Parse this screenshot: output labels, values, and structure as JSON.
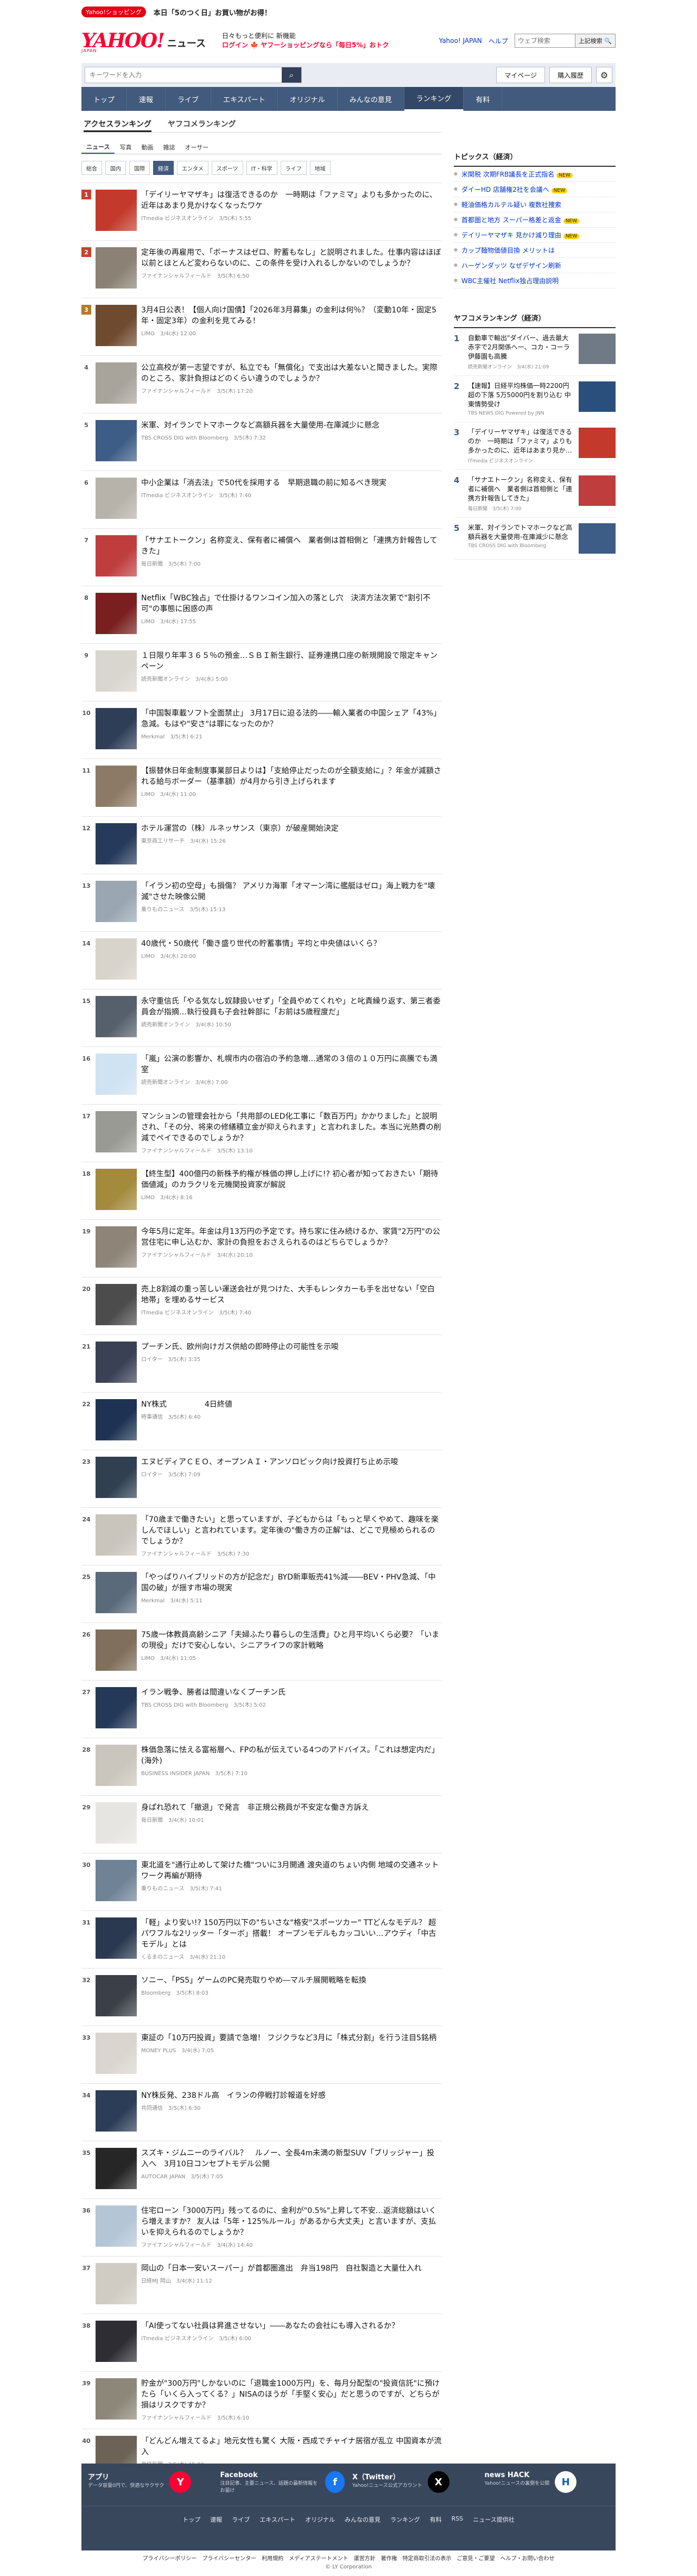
{
  "promo": {
    "pill": "Yahoo!ショッピング",
    "text": "本日「5のつく日」お買い物がお得！"
  },
  "header": {
    "logo_text": "YAHOO!",
    "logo_sub": "JAPAN",
    "section": "ニュース",
    "promo_l1": "日々もっと便利に 新機能",
    "promo_l2": "ログイン 🍁 ヤフーショッピングなら「毎日5%」おトク",
    "link_yj": "Yahoo! JAPAN",
    "link_help": "ヘルプ",
    "search_placeholder": "ウェブ検索",
    "search_btn": "上記検索 🔍"
  },
  "searchbar": {
    "placeholder": "キーワードを入力",
    "mypage": "マイページ",
    "subscribe": "購入履歴"
  },
  "mainnav": [
    "トップ",
    "速報",
    "ライブ",
    "エキスパート",
    "オリジナル",
    "みんなの意見",
    "ランキング",
    "有料"
  ],
  "mainnav_active": 6,
  "pagetabs": [
    "アクセスランキング",
    "ヤフコメランキング"
  ],
  "typetabs": [
    "ニュース",
    "写真",
    "動画",
    "雑誌",
    "オーサー"
  ],
  "cattabs": [
    "総合",
    "国内",
    "国際",
    "経済",
    "エンタメ",
    "スポーツ",
    "IT・科学",
    "ライフ",
    "地域"
  ],
  "ranking": [
    {
      "n": "1",
      "title": "「デイリーヤマザキ」は復活できるのか　一時期は「ファミマ」よりも多かったのに、近年はあまり見かけなくなったワケ",
      "meta": "ITmedia ビジネスオンライン　3/5(木) 5:55",
      "c": "#c33a2c"
    },
    {
      "n": "2",
      "title": "定年後の再雇用で、「ボーナスはゼロ、貯蓄もなし」と説明されました。仕事内容はほぼ以前とほとんど変わらないのに、この条件を受け入れるしかないのでしょうか？",
      "meta": "ファイナンシャルフィールド　3/5(木) 6:50",
      "c": "#8b8175"
    },
    {
      "n": "3",
      "title": "3月4日公表！【個人向け国債】「2026年3月募集」の金利は何％？（変動10年・固定5年・固定3年）の金利を見てみる！",
      "meta": "LIMO　3/4(水) 12:00",
      "c": "#6e4a2e"
    },
    {
      "n": "4",
      "title": "公立高校が第一志望ですが、私立でも「無償化」で支出は大差ないと聞きました。実際のところ、家計負担はどのくらい違うのでしょうか？",
      "meta": "ファイナンシャルフィールド　3/5(木) 17:20",
      "c": "#a8a39b"
    },
    {
      "n": "5",
      "title": "米軍、対イランでトマホークなど高額兵器を大量使用-在庫減少に懸念",
      "meta": "TBS CROSS DIG with Bloomberg　3/5(木) 7:32",
      "c": "#3d5c86"
    },
    {
      "n": "6",
      "title": "中小企業は「消去法」で50代を採用する　早期退職の前に知るべき現実",
      "meta": "ITmedia ビジネスオンライン　3/5(木) 7:40",
      "c": "#b8b3aa"
    },
    {
      "n": "7",
      "title": "「サナエトークン」名称変え、保有者に補償へ　業者側は首相側と「連携方針報告してきた」",
      "meta": "毎日新聞　3/5(木) 7:00",
      "c": "#bf3d3d"
    },
    {
      "n": "8",
      "title": "Netflix「WBC独占」で仕掛けるワンコイン加入の落とし穴　決済方法次第で\"割引不可\"の事態に困惑の声",
      "meta": "LIMO　3/4(水) 17:55",
      "c": "#7a1f1f"
    },
    {
      "n": "9",
      "title": "１日限り年率３６５％の預金…ＳＢＩ新生銀行、証券連携口座の新規開設で限定キャンペーン",
      "meta": "読売新聞オンライン　3/4(水) 5:00",
      "c": "#d9d5cf"
    },
    {
      "n": "10",
      "title": "「中国製車載ソフト全面禁止」 3月17日に迫る法的――輸入業者の中国シェア「43%」急減。もはや\"安さ\"は罪になったのか？",
      "meta": "Merkmal　3/5(木) 6:21",
      "c": "#2f3e57"
    },
    {
      "n": "11",
      "title": "【振替休日年金制度事業部日よりは】「支給停止だったのが全額支給に」？年金が減額される給与ボーダー（基準額）が4月から引き上げられます",
      "meta": "LIMO　3/4(水) 11:00",
      "c": "#8c7a66"
    },
    {
      "n": "12",
      "title": "ホテル運営の（株）ルネッサンス（東京）が破産開始決定",
      "meta": "東京商工リサーチ　3/4(水) 15:26",
      "c": "#263a5c"
    },
    {
      "n": "13",
      "title": "「イラン初の空母」も損傷？ アメリカ海軍「オマーン湾に艦艇はゼロ」海上戦力を\"壊滅\"させた映像公開",
      "meta": "乗りものニュース　3/5(木) 15:13",
      "c": "#9aa6b2"
    },
    {
      "n": "14",
      "title": "40歳代・50歳代「働き盛り世代の貯蓄事情」平均と中央値はいくら？",
      "meta": "LIMO　3/4(水) 20:00",
      "c": "#d8d3cb"
    },
    {
      "n": "15",
      "title": "永守重信氏「やる気なし奴隷扱いせず」「全員やめてくれや」と叱責繰り返す、第三者委員会が指摘…執行役員も子会社幹部に「お前は5歳程度だ」",
      "meta": "読売新聞オンライン　3/4(水) 10:50",
      "c": "#56606c"
    },
    {
      "n": "16",
      "title": "「嵐」公演の影響か、札幌市内の宿泊の予約急増…通常の３倍の１０万円に高騰でも満室",
      "meta": "読売新聞オンライン　3/4(水) 7:00",
      "c": "#cfe3f2"
    },
    {
      "n": "17",
      "title": "マンションの管理会社から「共用部のLED化工事に「数百万円」かかりました」と説明され、「その分、将来の修繕積立金が抑えられます」と言われました。本当に光熱費の削減でペイできるのでしょうか？",
      "meta": "ファイナンシャルフィールド　3/5(木) 13:10",
      "c": "#9a9a94"
    },
    {
      "n": "18",
      "title": "【終生型】400億円の新株予約権が株価の押し上げに!? 初心者が知っておきたい「期待価値減」のカラクリを元機関投資家が解説",
      "meta": "LIMO　3/4(水) 8:16",
      "c": "#a38a3c"
    },
    {
      "n": "19",
      "title": "今年5月に定年。年金は月13万円の予定です。持ち家に住み続けるか、家賃\"2万円\"の公営住宅に申し込むか、家計の負担をおさえられるのはどちらでしょうか？",
      "meta": "ファイナンシャルフィールド　3/4(水) 20:10",
      "c": "#8e8478"
    },
    {
      "n": "20",
      "title": "売上8割減の重っ苦しい運送会社が見つけた、大手もレンタカーも手を出せない「空白地帯」を埋めるサービス",
      "meta": "ITmedia ビジネスオンライン　3/5(木) 7:40",
      "c": "#4c4c4c"
    },
    {
      "n": "21",
      "title": "プーチン氏、欧州向けガス供給の即時停止の可能性を示唆",
      "meta": "ロイター　3/5(木) 3:35",
      "c": "#3a4155"
    },
    {
      "n": "22",
      "title": "NY株式　　　　　4日終値",
      "meta": "時事通信　3/5(木) 6:40",
      "c": "#1e3353"
    },
    {
      "n": "23",
      "title": "エヌビディアＣＥＯ、オープンＡＩ・アンソロピック向け投資打ち止め示唆",
      "meta": "ロイター　3/5(木) 7:09",
      "c": "#304050"
    },
    {
      "n": "24",
      "title": "「70歳まで働きたい」と思っていますが、子どもからは「もっと早くやめて、趣味を楽しんでほしい」と言われています。定年後の\"働き方の正解\"は、どこで見極められるのでしょうか？",
      "meta": "ファイナンシャルフィールド　3/5(木) 7:30",
      "c": "#c9c4bc"
    },
    {
      "n": "25",
      "title": "「やっぱりハイブリッドの方が記念だ」BYD新車販売41%減――BEV・PHV急減、「中国の破」が揺す市場の現実",
      "meta": "Merkmal　3/4(水) 5:11",
      "c": "#5a6a7b"
    },
    {
      "n": "26",
      "title": "75歳一体教員高齢シニア「夫婦ふたり暮らしの生活費」ひと月平均いくら必要？「いまの現役」だけで安心しない、シニアライフの家計戦略",
      "meta": "LIMO　3/4(水) 11:05",
      "c": "#7f6f5c"
    },
    {
      "n": "27",
      "title": "イラン戦争、勝者は間違いなくプーチン氏",
      "meta": "TBS CROSS DIG with Bloomberg　3/5(木) 5:02",
      "c": "#243858"
    },
    {
      "n": "28",
      "title": "株価急落に怯える富裕層へ、FPの私が伝えている4つのアドバイス。「これは想定内だ」(海外)",
      "meta": "BUSINESS INSIDER JAPAN　3/5(木) 7:10",
      "c": "#cbc6bd"
    },
    {
      "n": "29",
      "title": "身ぱれ恐れて「撤退」で発言　非正規公務員が不安定な働き方訴え",
      "meta": "毎日新聞　3/4(水) 10:01",
      "c": "#e7e5e1"
    },
    {
      "n": "30",
      "title": "東北道を\"通行止めして架けた橋\"ついに3月開通 渡央道のちょい内側 地域の交通ネットワーク再編が期待",
      "meta": "乗りものニュース　3/5(木) 7:41",
      "c": "#6f8296"
    },
    {
      "n": "31",
      "title": "「軽」より安い!? 150万円以下の\"ちいさな\"格安\"スポーツカー\" TTどんなモデル？ 超パワフルな2リッター「ターボ」搭載！ オープンモデルもカッコいい…アウディ「中古モデル」とは",
      "meta": "くるまのニュース　3/4(水) 21:10",
      "c": "#2a3950"
    },
    {
      "n": "32",
      "title": "ソニー、「PS5」ゲームのPC発売取りやめ―マルチ展開戦略を転換",
      "meta": "Bloomberg　3/5(木) 8:03",
      "c": "#3b4048"
    },
    {
      "n": "33",
      "title": "東証の「10万円投資」要請で急増！ フジクラなど3月に「株式分割」を行う注目5銘柄",
      "meta": "MONEY PLUS　3/4(水) 7:05",
      "c": "#dad6cf"
    },
    {
      "n": "34",
      "title": "NY株反発、238ドル高　イランの停戦打診報道を好感",
      "meta": "共同通信　3/5(木) 6:30",
      "c": "#2c3d57"
    },
    {
      "n": "35",
      "title": "スズキ・ジムニーのライバル？　ルノー、全長4m未満の新型SUV「ブリッジャー」投入へ　3月10日コンセプトモデル公開",
      "meta": "AUTOCAR JAPAN　3/5(木) 7:05",
      "c": "#262626"
    },
    {
      "n": "36",
      "title": "住宅ローン「3000万円」残ってるのに、金利が\"0.5%\"上昇して不安…返済総額はいくら増えますか？ 友人は「5年・125%ルール」があるから大丈夫」と言いますが、支払いを抑えられるのでしょうか？",
      "meta": "ファイナンシャルフィールド　3/4(水) 14:40",
      "c": "#b4c6d6"
    },
    {
      "n": "37",
      "title": "岡山の「日本一安いスーパー」が首都圏進出　弁当198円　自社製造と大量仕入れ",
      "meta": "日経MJ 岡山　3/4(水) 11:12",
      "c": "#d0ccc3"
    },
    {
      "n": "38",
      "title": "「AI使ってない社員は昇進させない」――あなたの会社にも導入されるか？",
      "meta": "ITmedia ビジネスオンライン　3/5(木) 6:00",
      "c": "#2d2d33"
    },
    {
      "n": "39",
      "title": "貯金が\"300万円\"しかないのに「退職金1000万円」を、毎月分配型の\"投資信託\"に預けたら「いくら入ってくる？」NISAのほうが「手堅く安心」だと思うのですが、どちらが損はリスクですか？",
      "meta": "ファイナンシャルフィールド　3/5(木) 6:10",
      "c": "#8c8778"
    },
    {
      "n": "40",
      "title": "「どんどん増えてるよ」地元女性も驚く 大阪・西成でチャイナ居宿が乱立 中国資本が流入",
      "meta": "産経新聞　3/5(木) 15:00",
      "c": "#6d6256"
    }
  ],
  "topics": {
    "heading": "トピックス（経済）",
    "items": [
      {
        "t": "米関税 次期FRB議長を正式指名",
        "new": true
      },
      {
        "t": "ダイーHD 店舗権2社を会議へ",
        "new": true
      },
      {
        "t": "軽油価格カルテル疑い 複数社捜索",
        "new": false
      },
      {
        "t": "首都圏と地方 スーパー格差と返金",
        "new": true
      },
      {
        "t": "デイリーヤマザキ 見かけ減り理由",
        "new": true
      },
      {
        "t": "カップ麺物価値目換 メリットは",
        "new": false
      },
      {
        "t": "ハーゲンダッツ なぜデザイン刷新",
        "new": false
      },
      {
        "t": "WBC主催社 Netflix独占理由説明",
        "new": false
      }
    ],
    "new_label": "NEW"
  },
  "comment_rank": {
    "heading": "ヤフコメランキング（経済）",
    "items": [
      {
        "n": "1",
        "t": "自動車で輸出\"ダイバー、過去最大赤字で2月関係ヘ一、コカ・コーラ伊藤園も高騰",
        "m": "読売新聞オンライン　3/4(水) 21:09",
        "c": "#6f7a86"
      },
      {
        "n": "2",
        "t": "【速報】日経平均株価一時2200円超の下落 5万5000円を割り込む 中東情勢受け",
        "m": "TBS NEWS DIG Powered by JNN",
        "c": "#2b4f7c"
      },
      {
        "n": "3",
        "t": "「デイリーヤマザキ」は復活できるのか　一時期は「ファミマ」よりも多かったのに、近年はあまり見かけなくなったワケ",
        "m": "ITmedia ビジネスオンライン",
        "c": "#c33a2c"
      },
      {
        "n": "4",
        "t": "「サナエトークン」名称変え、保有者に補償へ　業者側は首相側と「連携方針報告してきた」",
        "m": "毎日新聞　3/5(木) 7:00",
        "c": "#bf3d3d"
      },
      {
        "n": "5",
        "t": "米軍、対イランでトマホークなど高額兵器を大量使用-在庫減少に懸念",
        "m": "TBS CROSS DIG with Bloomberg",
        "c": "#3d5c86"
      }
    ]
  },
  "footer": {
    "apps": [
      {
        "title": "アプリ",
        "desc": "データ容量0円で、快適なサクサク",
        "icon": "Y",
        "bg": "#ff0033"
      },
      {
        "title": "Facebook",
        "desc": "注目記事、主要ニュース、話題の最新情報をお届け",
        "icon": "f",
        "bg": "#1877f2"
      },
      {
        "title": "X（Twitter）",
        "desc": "Yahoo!ニュース公式アカウント",
        "icon": "X",
        "bg": "#000000"
      },
      {
        "title": "news HACK",
        "desc": "Yahoo!ニュースの裏側を公開",
        "icon": "H",
        "bg": "#ffffff"
      }
    ],
    "nav": [
      "トップ",
      "速報",
      "ライブ",
      "エキスパート",
      "オリジナル",
      "みんなの意見",
      "ランキング",
      "有料",
      "RSS",
      "ニュース提供社"
    ],
    "legal": [
      "プライバシーポリシー",
      "プライバシーセンター",
      "利用規約",
      "メディアステートメント",
      "運営方針",
      "著作権",
      "特定商取引法の表示",
      "ご意見・ご要望",
      "ヘルプ・お問い合わせ"
    ],
    "copyright": "© LY Corporation"
  }
}
